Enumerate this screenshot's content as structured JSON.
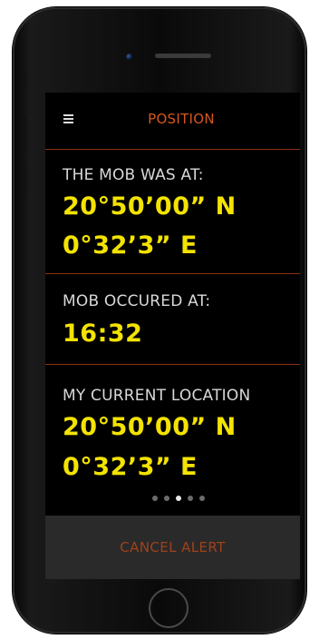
{
  "header": {
    "title": "POSITION",
    "menu_icon": "hamburger-menu-icon",
    "title_color": "#d4581e"
  },
  "mob_position": {
    "label": "THE MOB WAS AT:",
    "latitude": "20°50’00” N",
    "longitude": "0°32’3” E"
  },
  "mob_time": {
    "label": "MOB OCCURED AT:",
    "time": "16:32"
  },
  "current_location": {
    "label": "MY CURRENT LOCATION",
    "latitude": "20°50’00” N",
    "longitude": "0°32’3” E"
  },
  "pager": {
    "count": 5,
    "active_index": 2
  },
  "footer": {
    "cancel_label": "CANCEL ALERT"
  },
  "colors": {
    "accent": "#d4581e",
    "value_yellow": "#f3e300",
    "background": "#000000"
  }
}
